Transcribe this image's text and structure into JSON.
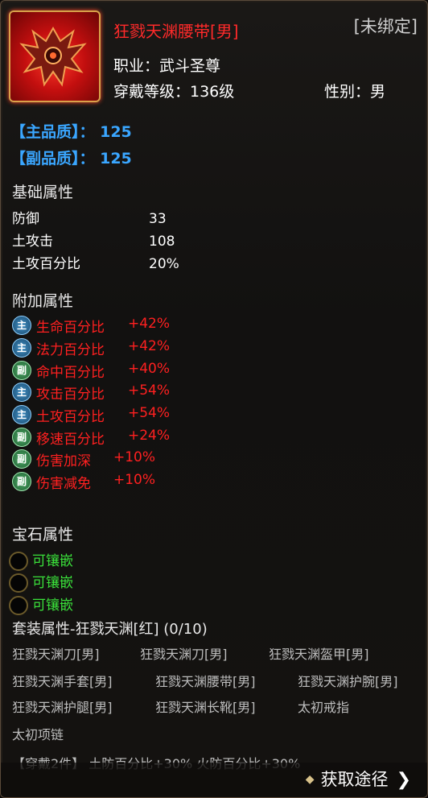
{
  "item": {
    "name": "狂戮天渊腰带[男]",
    "bind_status": "[未绑定]",
    "profession": "职业：武斗圣尊",
    "level": "穿戴等级：136级",
    "gender": "性别：男"
  },
  "quality": {
    "main": "【主品质】： 125",
    "sub": "【副品质】： 125"
  },
  "base_attrs": {
    "title": "基础属性",
    "rows": [
      {
        "name": "防御",
        "value": "33"
      },
      {
        "name": "土攻击",
        "value": "108"
      },
      {
        "name": "土攻百分比",
        "value": "20%"
      }
    ]
  },
  "extra_attrs": {
    "title": "附加属性",
    "rows": [
      {
        "badge": "主",
        "name": "生命百分比",
        "value": "+42%"
      },
      {
        "badge": "主",
        "name": "法力百分比",
        "value": "+42%"
      },
      {
        "badge": "副",
        "name": "命中百分比",
        "value": "+40%"
      },
      {
        "badge": "主",
        "name": "攻击百分比",
        "value": "+54%"
      },
      {
        "badge": "主",
        "name": "土攻百分比",
        "value": "+54%"
      },
      {
        "badge": "副",
        "name": "移速百分比",
        "value": "+24%"
      },
      {
        "badge": "副",
        "name": "伤害加深",
        "value": "+10%"
      },
      {
        "badge": "副",
        "name": "伤害减免",
        "value": "+10%"
      }
    ]
  },
  "gems": {
    "title": "宝石属性",
    "slots": [
      "可镶嵌",
      "可镶嵌",
      "可镶嵌"
    ]
  },
  "set": {
    "title": "套装属性-狂戮天渊[红] (0/10)",
    "items": [
      "狂戮天渊刀[男]",
      "狂戮天渊刀[男]",
      "狂戮天渊盔甲[男]",
      "狂戮天渊手套[男]",
      "狂戮天渊腰带[男]",
      "狂戮天渊护腕[男]",
      "狂戮天渊护腿[男]",
      "狂戮天渊长靴[男]",
      "太初戒指",
      "太初项链"
    ],
    "bonus": "【穿戴2件】 土防百分比+30%     火防百分比+30%"
  },
  "footer": {
    "get_button": "获取途径"
  },
  "colors": {
    "item_name": "#ff2a2a",
    "quality": "#3aa6ff",
    "extra_attr": "#ff2020",
    "gem_text": "#3ae03a"
  },
  "icons": [
    "belt-item-icon",
    "main-badge-icon",
    "sub-badge-icon",
    "gem-slot-icon",
    "diamond-icon",
    "chevron-right-icon"
  ]
}
